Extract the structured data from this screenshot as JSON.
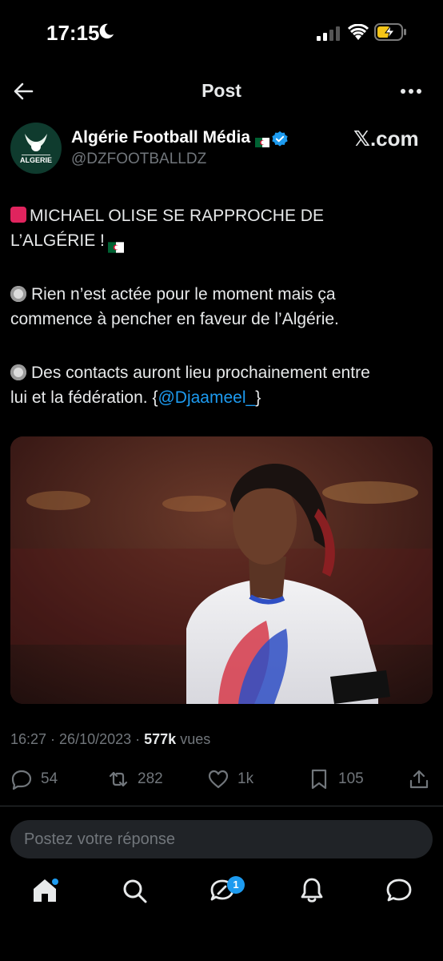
{
  "status": {
    "time": "17:15"
  },
  "nav": {
    "title": "Post"
  },
  "author": {
    "name": "Algérie Football Média",
    "handle": "@DZFOOTBALLDZ",
    "source": "𝕏.com",
    "avatar_text": "ALGERIE"
  },
  "tweet": {
    "line1": "MICHAEL OLISE SE RAPPROCHE DE",
    "line2": "L’ALGÉRIE !",
    "para2_line1": "Rien n’est actée pour le moment mais ça",
    "para2_line2": "commence à pencher en faveur de l’Algérie.",
    "para3_line1": "Des contacts auront lieu prochainement entre",
    "para3_line2_prefix": "lui et la fédération. {",
    "mention": "@Djaameel_",
    "para3_line2_suffix": "}"
  },
  "meta": {
    "time": "16:27",
    "sep1": " · ",
    "date": "26/10/2023",
    "sep2": " · ",
    "views_count": "577k",
    "views_label": " vues"
  },
  "actions": {
    "replies": "54",
    "reposts": "282",
    "likes": "1k",
    "bookmarks": "105"
  },
  "reply_box": {
    "placeholder": "Postez votre réponse"
  },
  "tabbar": {
    "messages_badge": "1"
  },
  "colors": {
    "accent": "#1d9bf0",
    "muted": "#71767b",
    "bg": "#000000"
  }
}
